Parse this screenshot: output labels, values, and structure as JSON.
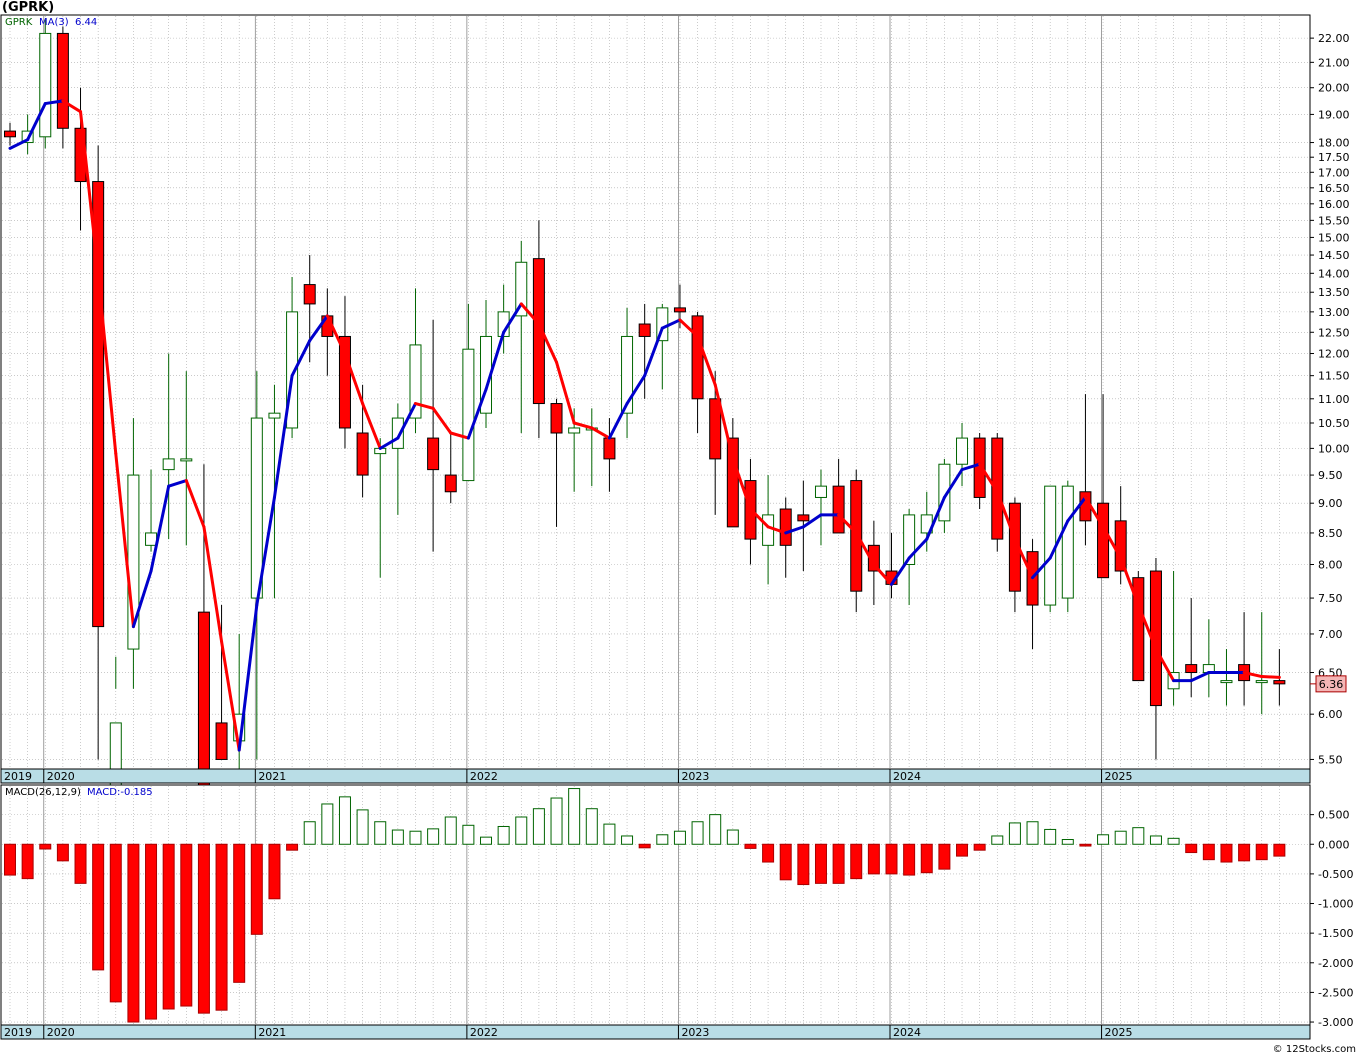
{
  "title": "(GPRK)",
  "credit": "© 12Stocks.com",
  "colors": {
    "up": "#006400",
    "down": "#ff0000",
    "ma_up": "#0000cc",
    "ma_down": "#ff0000",
    "axis_band": "#b9dde6",
    "last_label_bg": "#f4b6b6",
    "grid": "#aaaaaa"
  },
  "chart_data": [
    {
      "type": "candlestick",
      "symbol_label": "GPRK",
      "ma_label": "MA(3)",
      "ma_value": "6.44",
      "scale": "log",
      "ylim": [
        5.4,
        23.0
      ],
      "ticks": [
        "5.50",
        "6.00",
        "6.50",
        "7.00",
        "7.50",
        "8.00",
        "8.50",
        "9.00",
        "9.50",
        "10.00",
        "10.50",
        "11.00",
        "11.50",
        "12.00",
        "12.50",
        "13.00",
        "13.50",
        "14.00",
        "14.50",
        "15.00",
        "15.50",
        "16.00",
        "16.50",
        "17.00",
        "17.50",
        "18.00",
        "19.00",
        "20.00",
        "21.00",
        "22.00"
      ],
      "last_price": "6.36",
      "year_labels": [
        "2019",
        "2020",
        "2021",
        "2022",
        "2023",
        "2024",
        "2025"
      ],
      "months": [
        "2019-11",
        "2019-12",
        "2020-01",
        "2020-02",
        "2020-03",
        "2020-04",
        "2020-05",
        "2020-06",
        "2020-07",
        "2020-08",
        "2020-09",
        "2020-10",
        "2020-11",
        "2020-12",
        "2021-01",
        "2021-02",
        "2021-03",
        "2021-04",
        "2021-05",
        "2021-06",
        "2021-07",
        "2021-08",
        "2021-09",
        "2021-10",
        "2021-11",
        "2021-12",
        "2022-01",
        "2022-02",
        "2022-03",
        "2022-04",
        "2022-05",
        "2022-06",
        "2022-07",
        "2022-08",
        "2022-09",
        "2022-10",
        "2022-11",
        "2022-12",
        "2023-01",
        "2023-02",
        "2023-03",
        "2023-04",
        "2023-05",
        "2023-06",
        "2023-07",
        "2023-08",
        "2023-09",
        "2023-10",
        "2023-11",
        "2023-12",
        "2024-01",
        "2024-02",
        "2024-03",
        "2024-04",
        "2024-05",
        "2024-06",
        "2024-07",
        "2024-08",
        "2024-09",
        "2024-10",
        "2024-11",
        "2024-12",
        "2025-01",
        "2025-02",
        "2025-03",
        "2025-04",
        "2025-05",
        "2025-06",
        "2025-07",
        "2025-08",
        "2025-09",
        "2025-10",
        "2025-11"
      ],
      "open": [
        18.4,
        18.0,
        18.2,
        22.2,
        18.5,
        16.7,
        4.9,
        6.8,
        8.3,
        9.6,
        9.8,
        7.3,
        5.9,
        5.7,
        7.5,
        10.6,
        10.4,
        13.7,
        12.9,
        12.4,
        10.3,
        9.9,
        10.0,
        10.6,
        10.2,
        9.5,
        9.4,
        10.7,
        12.4,
        12.9,
        14.4,
        10.9,
        10.3,
        10.4,
        10.2,
        10.7,
        12.7,
        12.3,
        13.1,
        12.9,
        11.0,
        10.2,
        9.4,
        8.3,
        8.9,
        8.8,
        9.1,
        9.3,
        9.4,
        8.3,
        7.9,
        8.0,
        8.5,
        8.7,
        9.7,
        10.2,
        10.2,
        9.0,
        8.2,
        7.4,
        7.5,
        9.2,
        9.0,
        8.7,
        7.8,
        7.9,
        6.3,
        6.6,
        6.5,
        6.4,
        6.6,
        6.4,
        6.4
      ],
      "close": [
        18.2,
        18.4,
        22.2,
        18.5,
        16.7,
        7.1,
        5.9,
        9.5,
        8.5,
        9.8,
        9.8,
        5.2,
        5.5,
        6.0,
        10.6,
        10.7,
        13.0,
        13.2,
        12.4,
        10.4,
        9.5,
        10.0,
        10.6,
        12.2,
        9.6,
        9.2,
        12.1,
        12.4,
        13.0,
        14.3,
        10.9,
        10.3,
        10.4,
        10.4,
        9.8,
        12.4,
        12.4,
        13.1,
        13.0,
        11.0,
        9.8,
        8.6,
        8.4,
        8.8,
        8.3,
        8.7,
        9.3,
        8.5,
        7.6,
        7.9,
        7.7,
        8.8,
        8.8,
        9.7,
        10.2,
        9.1,
        8.4,
        7.6,
        7.4,
        9.3,
        9.3,
        8.7,
        7.8,
        7.9,
        6.4,
        6.1,
        6.5,
        6.5,
        6.6,
        6.4,
        6.4,
        6.4,
        6.36
      ],
      "high": [
        18.7,
        19.0,
        22.8,
        22.5,
        20.0,
        17.9,
        6.7,
        10.6,
        9.6,
        12.0,
        11.6,
        9.7,
        7.4,
        7.0,
        11.6,
        11.3,
        13.9,
        14.5,
        13.6,
        13.4,
        11.3,
        10.2,
        10.9,
        13.6,
        12.8,
        10.3,
        13.2,
        13.3,
        13.7,
        14.9,
        15.5,
        11.0,
        10.8,
        10.8,
        10.6,
        13.1,
        13.2,
        13.2,
        13.7,
        13.0,
        11.6,
        10.6,
        9.8,
        9.5,
        9.1,
        9.4,
        9.6,
        9.8,
        9.6,
        8.7,
        8.5,
        8.9,
        9.2,
        9.8,
        10.5,
        10.3,
        10.3,
        9.1,
        8.4,
        8.4,
        9.4,
        11.1,
        11.1,
        9.3,
        7.9,
        8.1,
        7.9,
        7.5,
        7.2,
        6.8,
        7.3,
        7.3,
        6.8
      ],
      "low": [
        17.9,
        17.6,
        17.8,
        17.8,
        15.2,
        5.5,
        6.3,
        6.3,
        8.2,
        8.4,
        8.3,
        7.2,
        5.6,
        5.4,
        5.5,
        7.5,
        10.2,
        11.8,
        11.5,
        10.0,
        9.1,
        7.8,
        8.8,
        10.3,
        8.2,
        9.0,
        9.5,
        10.4,
        12.0,
        10.3,
        10.2,
        8.6,
        9.2,
        9.3,
        9.2,
        10.2,
        11.0,
        11.2,
        12.6,
        10.3,
        8.8,
        9.2,
        8.0,
        7.7,
        7.8,
        7.9,
        8.3,
        8.5,
        7.3,
        7.4,
        7.5,
        7.4,
        8.2,
        8.5,
        9.3,
        8.9,
        8.2,
        7.3,
        6.8,
        7.3,
        7.3,
        8.3,
        8.5,
        7.7,
        6.9,
        5.5,
        6.1,
        6.2,
        6.2,
        6.1,
        6.1,
        6.0,
        6.1
      ],
      "ma": [
        17.8,
        18.1,
        19.4,
        19.5,
        19.1,
        14.0,
        9.9,
        7.1,
        7.9,
        9.3,
        9.4,
        8.6,
        6.9,
        5.6,
        7.4,
        9.1,
        11.5,
        12.3,
        12.9,
        12.0,
        10.9,
        10.0,
        10.2,
        10.9,
        10.8,
        10.3,
        10.2,
        11.2,
        12.5,
        13.2,
        12.7,
        11.8,
        10.5,
        10.4,
        10.2,
        10.9,
        11.5,
        12.6,
        12.8,
        12.4,
        11.3,
        9.8,
        8.9,
        8.6,
        8.5,
        8.6,
        8.8,
        8.8,
        8.5,
        8.0,
        7.7,
        8.1,
        8.4,
        9.1,
        9.6,
        9.7,
        9.2,
        8.4,
        7.8,
        8.1,
        8.7,
        9.1,
        8.6,
        8.1,
        7.4,
        6.8,
        6.4,
        6.4,
        6.5,
        6.5,
        6.5,
        6.45,
        6.44
      ]
    },
    {
      "type": "bar",
      "label": "MACD(26,12,9)",
      "value_label": "MACD:-0.185",
      "ylim": [
        -3.05,
        1.0
      ],
      "ticks": [
        "0.500",
        "0.000",
        "-0.500",
        "-1.000",
        "-1.500",
        "-2.000",
        "-2.500",
        "-3.000"
      ],
      "year_labels": [
        "2019",
        "2020",
        "2021",
        "2022",
        "2023",
        "2024",
        "2025"
      ],
      "values": [
        -0.52,
        -0.58,
        -0.08,
        -0.28,
        -0.66,
        -2.12,
        -2.66,
        -3.0,
        -2.95,
        -2.78,
        -2.73,
        -2.85,
        -2.8,
        -2.33,
        -1.52,
        -0.92,
        -0.1,
        0.38,
        0.68,
        0.8,
        0.58,
        0.38,
        0.24,
        0.22,
        0.26,
        0.46,
        0.32,
        0.12,
        0.3,
        0.46,
        0.6,
        0.78,
        0.94,
        0.6,
        0.34,
        0.14,
        -0.06,
        0.16,
        0.22,
        0.38,
        0.5,
        0.24,
        -0.07,
        -0.3,
        -0.6,
        -0.68,
        -0.66,
        -0.66,
        -0.58,
        -0.5,
        -0.5,
        -0.52,
        -0.48,
        -0.42,
        -0.2,
        -0.1,
        0.14,
        0.36,
        0.38,
        0.25,
        0.08,
        -0.03,
        0.16,
        0.22,
        0.28,
        0.14,
        0.1,
        -0.14,
        -0.26,
        -0.3,
        -0.28,
        -0.26,
        -0.2
      ]
    }
  ]
}
